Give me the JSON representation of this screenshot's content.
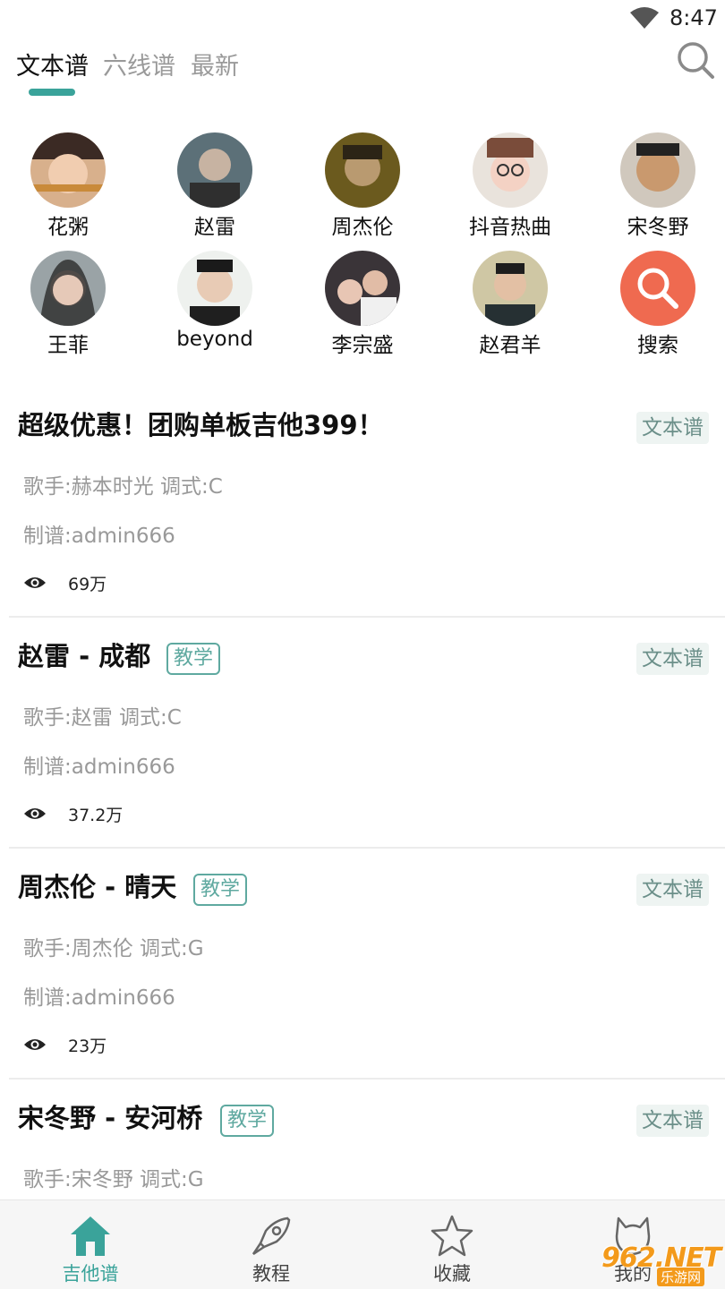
{
  "status_bar": {
    "time": "8:47",
    "wifi_icon": "wifi-icon"
  },
  "top_tabs": {
    "items": [
      {
        "label": "文本谱",
        "active": true
      },
      {
        "label": "六线谱",
        "active": false
      },
      {
        "label": "最新",
        "active": false
      }
    ],
    "search_icon": "search-icon",
    "accent_color": "#3aa39a"
  },
  "artists": [
    {
      "name": "花粥",
      "icon": "avatar-photo"
    },
    {
      "name": "赵雷",
      "icon": "avatar-photo"
    },
    {
      "name": "周杰伦",
      "icon": "avatar-photo"
    },
    {
      "name": "抖音热曲",
      "icon": "avatar-photo"
    },
    {
      "name": "宋冬野",
      "icon": "avatar-photo"
    },
    {
      "name": "王菲",
      "icon": "avatar-photo"
    },
    {
      "name": "beyond",
      "icon": "avatar-photo"
    },
    {
      "name": "李宗盛",
      "icon": "avatar-photo"
    },
    {
      "name": "赵君羊",
      "icon": "avatar-photo"
    },
    {
      "name": "搜索",
      "icon": "search-icon",
      "color": "#ef6a50"
    }
  ],
  "songs": [
    {
      "title": "超级优惠！团购单板吉他399！",
      "teach_badge": "",
      "type_badge": "文本谱",
      "singer_key": "歌手:赫本时光  调式:C",
      "author": "制谱:admin666",
      "views": "69万"
    },
    {
      "title": "赵雷 - 成都",
      "teach_badge": "教学",
      "type_badge": "文本谱",
      "singer_key": "歌手:赵雷  调式:C",
      "author": "制谱:admin666",
      "views": "37.2万"
    },
    {
      "title": "周杰伦 - 晴天",
      "teach_badge": "教学",
      "type_badge": "文本谱",
      "singer_key": "歌手:周杰伦  调式:G",
      "author": "制谱:admin666",
      "views": "23万"
    },
    {
      "title": "宋冬野 - 安河桥",
      "teach_badge": "教学",
      "type_badge": "文本谱",
      "singer_key": "歌手:宋冬野  调式:G",
      "author": "",
      "views": ""
    }
  ],
  "bottom_nav": {
    "items": [
      {
        "label": "吉他谱",
        "icon": "home-icon",
        "active": true
      },
      {
        "label": "教程",
        "icon": "rocket-icon",
        "active": false
      },
      {
        "label": "收藏",
        "icon": "star-icon",
        "active": false
      },
      {
        "label": "我的",
        "icon": "cat-icon",
        "active": false
      }
    ]
  },
  "watermark": {
    "main": "962.NET",
    "sub": "乐游网"
  }
}
